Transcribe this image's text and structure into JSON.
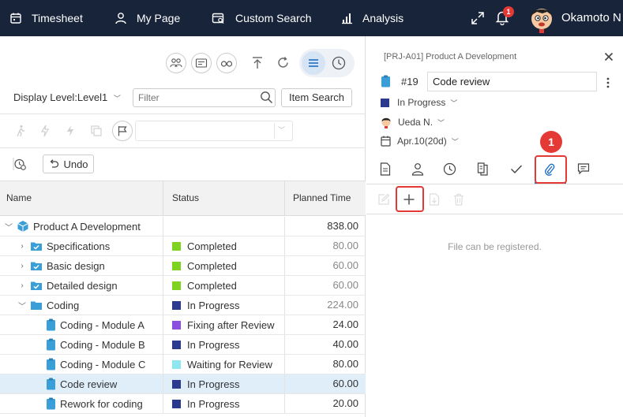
{
  "topbar": {
    "nav": [
      "Timesheet",
      "My Page",
      "Custom Search",
      "Analysis"
    ],
    "notification_count": "1",
    "user_name": "Okamoto N"
  },
  "left": {
    "display_level": "Display Level:Level1",
    "filter_placeholder": "Filter",
    "item_search_label": "Item Search",
    "undo_label": "Undo",
    "columns": {
      "name": "Name",
      "status": "Status",
      "planned": "Planned Time"
    },
    "rows": [
      {
        "name": "Product A Development",
        "status": "",
        "status_color": "",
        "planned": "838.00"
      },
      {
        "name": "Specifications",
        "status": "Completed",
        "status_color": "#7ed321",
        "planned": "80.00"
      },
      {
        "name": "Basic design",
        "status": "Completed",
        "status_color": "#7ed321",
        "planned": "60.00"
      },
      {
        "name": "Detailed design",
        "status": "Completed",
        "status_color": "#7ed321",
        "planned": "60.00"
      },
      {
        "name": "Coding",
        "status": "In Progress",
        "status_color": "#2b3a8f",
        "planned": "224.00"
      },
      {
        "name": "Coding - Module A",
        "status": "Fixing after Review",
        "status_color": "#8a4fe0",
        "planned": "24.00"
      },
      {
        "name": "Coding - Module B",
        "status": "In Progress",
        "status_color": "#2b3a8f",
        "planned": "40.00"
      },
      {
        "name": "Coding - Module C",
        "status": "Waiting for Review",
        "status_color": "#8ee6f0",
        "planned": "80.00"
      },
      {
        "name": "Code review",
        "status": "In Progress",
        "status_color": "#2b3a8f",
        "planned": "60.00"
      },
      {
        "name": "Rework for coding",
        "status": "In Progress",
        "status_color": "#2b3a8f",
        "planned": "20.00"
      }
    ]
  },
  "detail": {
    "breadcrumb": "[PRJ-A01] Product A Development",
    "task_number": "#19",
    "task_title": "Code review",
    "status": "In Progress",
    "status_color": "#2b3a8f",
    "assignee": "Ueda N.",
    "date": "Apr.10(20d)",
    "callout_number": "1",
    "empty_message": "File can be registered."
  }
}
